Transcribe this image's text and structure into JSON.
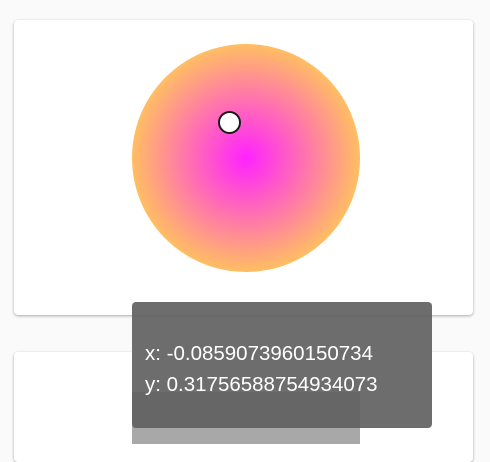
{
  "picker": {
    "colors": {
      "center": "#ff22ff",
      "edge": "#ffff22"
    },
    "handle_value": {
      "x": -0.0859073960150734,
      "y": 0.31756588754934073
    }
  },
  "tooltip": {
    "x_text": "x: -0.0859073960150734",
    "y_text": "y: 0.31756588754934073"
  }
}
